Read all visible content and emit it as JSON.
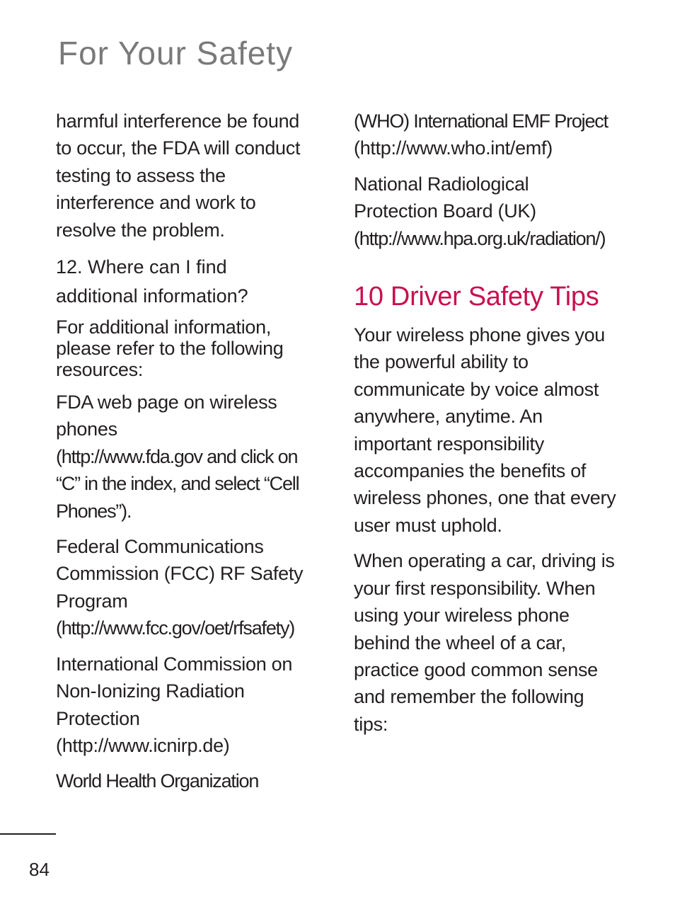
{
  "header": {
    "title": "For Your Safety"
  },
  "left_column": {
    "intro_lines": [
      "harmful interference be found",
      "to occur, the FDA will conduct",
      "testing to assess the",
      "interference and work to",
      "resolve the problem."
    ],
    "question_lines": [
      "12. Where can I find",
      "additional information?"
    ],
    "answer_lines": [
      "For additional information,",
      "please refer to the following",
      "resources:"
    ],
    "resources": [
      {
        "name_lines": [
          "FDA web page on wireless",
          "phones"
        ],
        "url_lines": [
          "(http://www.fda.gov and click on",
          "“C” in the index, and select “Cell",
          "Phones”)."
        ]
      },
      {
        "name_lines": [
          "Federal Communications",
          "Commission (FCC) RF Safety",
          "Program"
        ],
        "url_lines": [
          "(http://www.fcc.gov/oet/rfsafety)"
        ]
      },
      {
        "name_lines": [
          "International Commission on",
          "Non-Ionizing Radiation",
          "Protection"
        ],
        "url_lines": [
          "(http://www.icnirp.de)"
        ]
      },
      {
        "name_lines": [
          "World Health Organization"
        ]
      }
    ]
  },
  "right_column": {
    "who_continued": [
      "(WHO) International EMF Project",
      "(http://www.who.int/emf)"
    ],
    "nrpb": {
      "name_lines": [
        "National Radiological",
        "Protection Board (UK)"
      ],
      "url_lines": [
        "(http://www.hpa.org.uk/radiation/)"
      ]
    },
    "section_title": "10 Driver Safety Tips",
    "paragraph1_lines": [
      "Your wireless phone gives you",
      "the powerful ability to",
      "communicate by voice almost",
      "anywhere, anytime. An",
      "important responsibility",
      "accompanies the benefits of",
      "wireless phones, one that every",
      "user must uphold."
    ],
    "paragraph2_lines": [
      "When operating a car, driving is",
      "your first responsibility. When",
      "using your wireless phone",
      "behind the wheel of a car,",
      "practice good common sense",
      "and remember the following",
      "tips:"
    ]
  },
  "footer": {
    "page_number": "84"
  },
  "colors": {
    "title_gray": "#7a7a7a",
    "accent": "#c8104f",
    "text": "#231f20"
  }
}
